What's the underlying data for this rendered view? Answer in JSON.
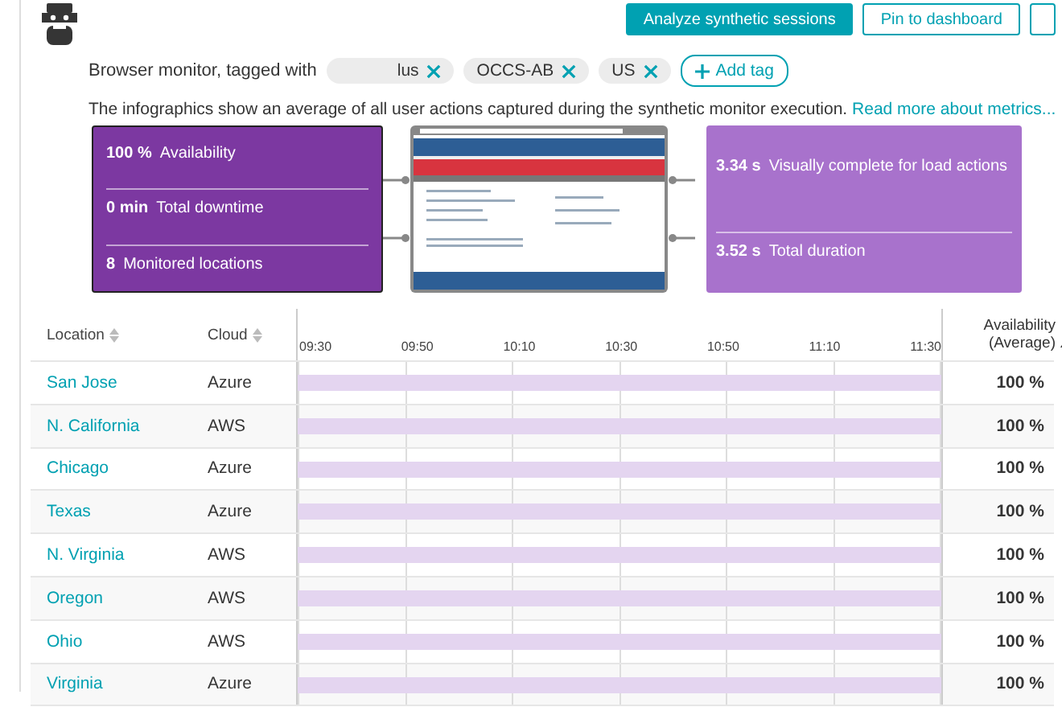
{
  "actions": [
    {
      "label": "Analyze synthetic sessions",
      "kind": "primary"
    },
    {
      "label": "Pin to dashboard",
      "kind": "secondary"
    }
  ],
  "monitor": {
    "text": "Browser monitor, tagged with",
    "tags": [
      "lus",
      "OCCS-AB",
      "US"
    ],
    "add_tag": "Add tag"
  },
  "description": {
    "text": "The infographics show an average of all user actions captured during the synthetic monitor execution.",
    "link": "Read more about metrics..."
  },
  "left_metrics": [
    {
      "value": "100 %",
      "label": "Availability"
    },
    {
      "value": "0 min",
      "label": "Total downtime"
    },
    {
      "value": "8",
      "label": "Monitored locations"
    }
  ],
  "right_metrics": [
    {
      "value": "3.34 s",
      "label": "Visually complete for load actions"
    },
    {
      "value": "3.52 s",
      "label": "Total duration"
    }
  ],
  "table": {
    "columns": [
      "Location",
      "Cloud",
      "Availability (Average)"
    ],
    "time_ticks": [
      "09:30",
      "09:50",
      "10:10",
      "10:30",
      "10:50",
      "11:10",
      "11:30"
    ],
    "rows": [
      {
        "location": "San Jose",
        "cloud": "Azure",
        "availability": "100 %"
      },
      {
        "location": "N. California",
        "cloud": "AWS",
        "availability": "100 %"
      },
      {
        "location": "Chicago",
        "cloud": "Azure",
        "availability": "100 %"
      },
      {
        "location": "Texas",
        "cloud": "Azure",
        "availability": "100 %"
      },
      {
        "location": "N. Virginia",
        "cloud": "AWS",
        "availability": "100 %"
      },
      {
        "location": "Oregon",
        "cloud": "AWS",
        "availability": "100 %"
      },
      {
        "location": "Ohio",
        "cloud": "AWS",
        "availability": "100 %"
      },
      {
        "location": "Virginia",
        "cloud": "Azure",
        "availability": "100 %"
      }
    ]
  }
}
